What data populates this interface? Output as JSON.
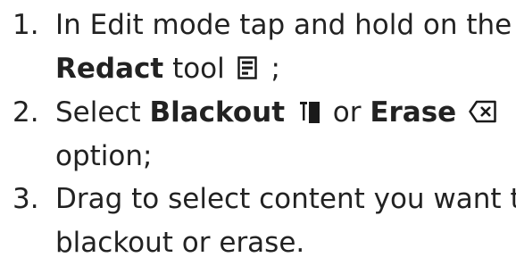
{
  "steps": [
    {
      "number": "1.",
      "line1": "In Edit mode tap and hold on the",
      "tool_name": "Redact",
      "tool_word": "tool",
      "end": ";",
      "icon": "redact-icon"
    },
    {
      "number": "2.",
      "select_word": "Select",
      "option1": "Blackout",
      "or_word": "or",
      "option2": "Erase",
      "line2": "option;",
      "icon1": "blackout-icon",
      "icon2": "erase-icon"
    },
    {
      "number": "3.",
      "line1": "Drag to select content you want to",
      "line2": "blackout or erase."
    }
  ],
  "colors": {
    "text": "#222222",
    "icon": "#1a1a1a"
  }
}
